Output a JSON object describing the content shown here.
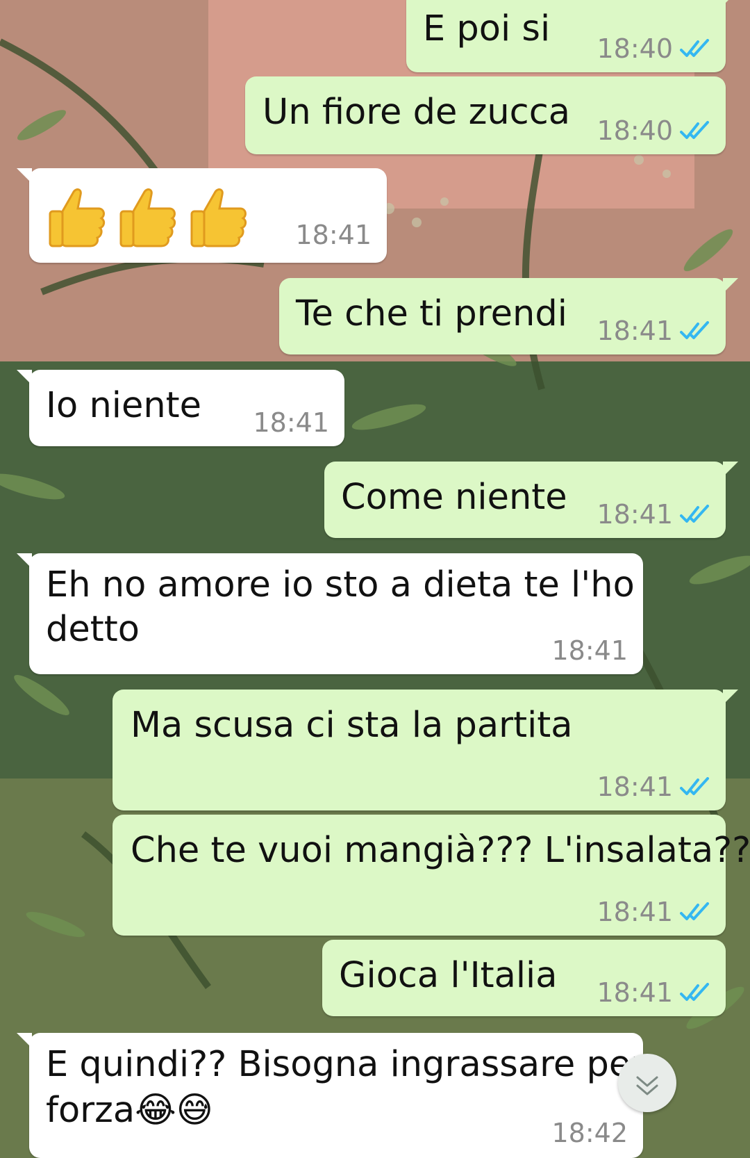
{
  "messages": [
    {
      "text": "E poi si",
      "time": "18:40",
      "direction": "outgoing",
      "status": "read"
    },
    {
      "text": "Un fiore de zucca",
      "time": "18:40",
      "direction": "outgoing",
      "status": "read"
    },
    {
      "text": "👍👍👍",
      "time": "18:41",
      "direction": "incoming"
    },
    {
      "text": "Te che ti prendi",
      "time": "18:41",
      "direction": "outgoing",
      "status": "read"
    },
    {
      "text": "Io niente",
      "time": "18:41",
      "direction": "incoming"
    },
    {
      "text": "Come niente",
      "time": "18:41",
      "direction": "outgoing",
      "status": "read"
    },
    {
      "text_line1": "Eh no amore io sto a dieta te l'ho",
      "text_line2": "detto",
      "time": "18:41",
      "direction": "incoming"
    },
    {
      "text": "Ma scusa ci sta la partita",
      "time": "18:41",
      "direction": "outgoing",
      "status": "read"
    },
    {
      "text": "Che te vuoi mangià??? L'insalata??",
      "time": "18:41",
      "direction": "outgoing",
      "status": "read"
    },
    {
      "text": "Gioca l'Italia",
      "time": "18:41",
      "direction": "outgoing",
      "status": "read"
    },
    {
      "text_line1": "E quindi?? Bisogna ingrassare per",
      "text_line2": "forza😂😅",
      "time": "18:42",
      "direction": "incoming"
    }
  ],
  "icons": {
    "read_receipt": "double-check-icon",
    "scroll_down": "chevron-down-icon",
    "thumbs_up": "thumbs-up-emoji",
    "laughing": "tears-of-joy-emoji",
    "sweat_smile": "grinning-sweat-emoji"
  },
  "colors": {
    "outgoing_bubble": "#dcf8c6",
    "incoming_bubble": "#ffffff",
    "read_tick": "#34b7f1",
    "timestamp": "#8a8a8a"
  }
}
